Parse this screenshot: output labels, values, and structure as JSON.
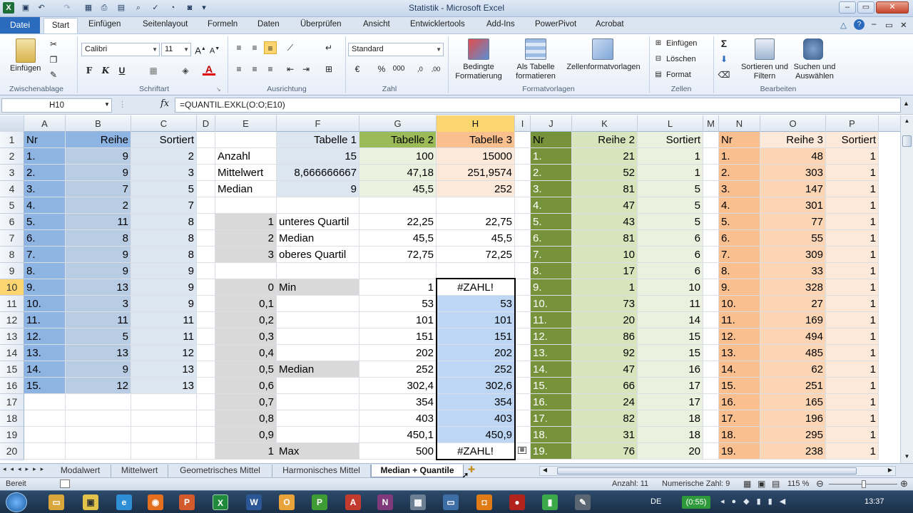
{
  "window": {
    "title": "Statistik - Microsoft Excel"
  },
  "ribbon_tabs": [
    "Datei",
    "Start",
    "Einfügen",
    "Seitenlayout",
    "Formeln",
    "Daten",
    "Überprüfen",
    "Ansicht",
    "Entwicklertools",
    "Add-Ins",
    "PowerPivot",
    "Acrobat"
  ],
  "ribbon": {
    "clipboard": {
      "paste": "Einfügen",
      "group": "Zwischenablage"
    },
    "font": {
      "name": "Calibri",
      "size": "11",
      "bold": "F",
      "italic": "K",
      "underline": "U",
      "group": "Schriftart"
    },
    "alignment": {
      "group": "Ausrichtung"
    },
    "number": {
      "format": "Standard",
      "percent": "%",
      "thousands": "000",
      "group": "Zahl"
    },
    "styles": {
      "conditional": "Bedingte Formatierung",
      "as_table": "Als Tabelle formatieren",
      "cell_styles": "Zellenformatvorlagen",
      "group": "Formatvorlagen"
    },
    "cells": {
      "insert": "Einfügen",
      "delete": "Löschen",
      "format": "Format",
      "group": "Zellen"
    },
    "editing": {
      "sigma": "Σ",
      "sort": "Sortieren und Filtern",
      "find": "Suchen und Auswählen",
      "group": "Bearbeiten"
    }
  },
  "formula_bar": {
    "name_box": "H10",
    "fx": "fx",
    "formula": "=QUANTIL.EXKL(O:O;E10)"
  },
  "columns": [
    "A",
    "B",
    "C",
    "D",
    "E",
    "F",
    "G",
    "H",
    "I",
    "J",
    "K",
    "L",
    "M",
    "N",
    "O",
    "P"
  ],
  "rows": [
    "1",
    "2",
    "3",
    "4",
    "5",
    "6",
    "7",
    "8",
    "9",
    "10",
    "11",
    "12",
    "13",
    "14",
    "15",
    "16",
    "17",
    "18",
    "19",
    "20"
  ],
  "cells": {
    "A": [
      "Nr",
      "1.",
      "2.",
      "3.",
      "4.",
      "5.",
      "6.",
      "7.",
      "8.",
      "9.",
      "10.",
      "11.",
      "12.",
      "13.",
      "14.",
      "15.",
      "",
      "",
      "",
      ""
    ],
    "B": [
      "Reihe",
      "9",
      "9",
      "7",
      "2",
      "11",
      "8",
      "9",
      "9",
      "13",
      "3",
      "11",
      "5",
      "13",
      "9",
      "12",
      "",
      "",
      "",
      ""
    ],
    "C": [
      "Sortiert",
      "2",
      "3",
      "5",
      "7",
      "8",
      "8",
      "8",
      "9",
      "9",
      "9",
      "11",
      "11",
      "12",
      "13",
      "13",
      "",
      "",
      "",
      ""
    ],
    "E": [
      "",
      "Anzahl",
      "Mittelwert",
      "Median",
      "",
      "1",
      "2",
      "3",
      "",
      "0",
      "0,1",
      "0,2",
      "0,3",
      "0,4",
      "0,5",
      "0,6",
      "0,7",
      "0,8",
      "0,9",
      "1"
    ],
    "F": [
      "Tabelle 1",
      "15",
      "8,666666667",
      "9",
      "",
      "unteres Quartil",
      "Median",
      "oberes Quartil",
      "",
      "Min",
      "",
      "",
      "",
      "",
      "Median",
      "",
      "",
      "",
      "",
      "Max"
    ],
    "G": [
      "Tabelle 2",
      "100",
      "47,18",
      "45,5",
      "",
      "22,25",
      "45,5",
      "72,75",
      "",
      "1",
      "53",
      "101",
      "151",
      "202",
      "252",
      "302,4",
      "354",
      "403",
      "450,1",
      "500"
    ],
    "H": [
      "Tabelle 3",
      "15000",
      "251,9574",
      "252",
      "",
      "22,75",
      "45,5",
      "72,25",
      "",
      "#ZAHL!",
      "53",
      "101",
      "151",
      "202",
      "252",
      "302,6",
      "354",
      "403",
      "450,9",
      "#ZAHL!"
    ],
    "J": [
      "Nr",
      "1.",
      "2.",
      "3.",
      "4.",
      "5.",
      "6.",
      "7.",
      "8.",
      "9.",
      "10.",
      "11.",
      "12.",
      "13.",
      "14.",
      "15.",
      "16.",
      "17.",
      "18.",
      "19."
    ],
    "K": [
      "Reihe 2",
      "21",
      "52",
      "81",
      "47",
      "43",
      "81",
      "10",
      "17",
      "1",
      "73",
      "20",
      "86",
      "92",
      "47",
      "66",
      "24",
      "82",
      "31",
      "76"
    ],
    "L": [
      "Sortiert",
      "1",
      "1",
      "5",
      "5",
      "5",
      "6",
      "6",
      "6",
      "10",
      "11",
      "14",
      "15",
      "15",
      "16",
      "17",
      "17",
      "18",
      "18",
      "20"
    ],
    "N": [
      "Nr",
      "1.",
      "2.",
      "3.",
      "4.",
      "5.",
      "6.",
      "7.",
      "8.",
      "9.",
      "10.",
      "11.",
      "12.",
      "13.",
      "14.",
      "15.",
      "16.",
      "17.",
      "18.",
      "19."
    ],
    "O": [
      "Reihe 3",
      "48",
      "303",
      "147",
      "301",
      "77",
      "55",
      "309",
      "33",
      "328",
      "27",
      "169",
      "494",
      "485",
      "62",
      "251",
      "165",
      "196",
      "295",
      "238"
    ],
    "P": [
      "Sortiert",
      "1",
      "1",
      "1",
      "1",
      "1",
      "1",
      "1",
      "1",
      "1",
      "1",
      "1",
      "1",
      "1",
      "1",
      "1",
      "1",
      "1",
      "1",
      "1"
    ]
  },
  "sheet_tabs": [
    "Modalwert",
    "Mittelwert",
    "Geometrisches Mittel",
    "Harmonisches Mittel",
    "Median + Quantile"
  ],
  "status": {
    "ready": "Bereit",
    "count": "Anzahl: 11",
    "numeric_count": "Numerische Zahl: 9",
    "zoom": "115 %"
  },
  "taskbar": {
    "lang": "DE",
    "clock": "13:37",
    "timer": "(0:55)"
  },
  "colors": {
    "accent_blue": "#2a6bbd",
    "selection_header": "#fbd570",
    "fill_blue_dark": "#8db4e2",
    "fill_blue_light": "#dce6f1",
    "fill_green_dark": "#76933c",
    "fill_green_light": "#d8e4bc",
    "fill_orange_dark": "#fabf8f",
    "fill_orange_light": "#fde9d9"
  }
}
